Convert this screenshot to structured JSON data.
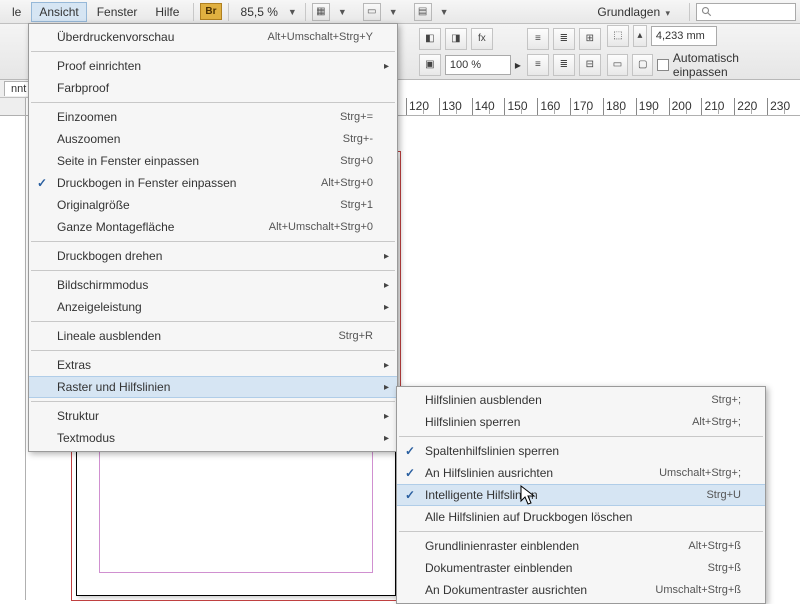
{
  "menubar": {
    "items_left": [
      "le"
    ],
    "items": [
      "Ansicht",
      "Fenster",
      "Hilfe"
    ],
    "bridge": "Br",
    "zoom": "85,5 %",
    "workspace": "Grundlagen"
  },
  "toolbar": {
    "pct": "100 %",
    "field_value": "4,233 mm",
    "fx_label": "fx",
    "autofit": "Automatisch einpassen"
  },
  "ruler": {
    "ticks": [
      "120",
      "130",
      "140",
      "150",
      "160",
      "170",
      "180",
      "190",
      "200",
      "210",
      "220",
      "230"
    ]
  },
  "tab": {
    "label": "nnt"
  },
  "view_menu": {
    "groups": [
      [
        {
          "label": "Überdruckenvorschau",
          "shortcut": "Alt+Umschalt+Strg+Y"
        }
      ],
      [
        {
          "label": "Proof einrichten",
          "sub": true
        },
        {
          "label": "Farbproof"
        }
      ],
      [
        {
          "label": "Einzoomen",
          "shortcut": "Strg+="
        },
        {
          "label": "Auszoomen",
          "shortcut": "Strg+-"
        },
        {
          "label": "Seite in Fenster einpassen",
          "shortcut": "Strg+0"
        },
        {
          "label": "Druckbogen in Fenster einpassen",
          "shortcut": "Alt+Strg+0",
          "checked": true
        },
        {
          "label": "Originalgröße",
          "shortcut": "Strg+1"
        },
        {
          "label": "Ganze Montagefläche",
          "shortcut": "Alt+Umschalt+Strg+0"
        }
      ],
      [
        {
          "label": "Druckbogen drehen",
          "sub": true
        }
      ],
      [
        {
          "label": "Bildschirmmodus",
          "sub": true
        },
        {
          "label": "Anzeigeleistung",
          "sub": true
        }
      ],
      [
        {
          "label": "Lineale ausblenden",
          "shortcut": "Strg+R"
        }
      ],
      [
        {
          "label": "Extras",
          "sub": true
        },
        {
          "label": "Raster und Hilfslinien",
          "sub": true,
          "hover": true
        }
      ],
      [
        {
          "label": "Struktur",
          "sub": true
        },
        {
          "label": "Textmodus",
          "sub": true
        }
      ]
    ]
  },
  "grid_submenu": {
    "groups": [
      [
        {
          "label": "Hilfslinien ausblenden",
          "shortcut": "Strg+;"
        },
        {
          "label": "Hilfslinien sperren",
          "shortcut": "Alt+Strg+;"
        }
      ],
      [
        {
          "label": "Spaltenhilfslinien sperren",
          "checked": true
        },
        {
          "label": "An Hilfslinien ausrichten",
          "shortcut": "Umschalt+Strg+;",
          "checked": true
        },
        {
          "label": "Intelligente Hilfslinien",
          "shortcut": "Strg+U",
          "checked": true,
          "hover": true
        },
        {
          "label": "Alle Hilfslinien auf Druckbogen löschen"
        }
      ],
      [
        {
          "label": "Grundlinienraster einblenden",
          "shortcut": "Alt+Strg+ß"
        },
        {
          "label": "Dokumentraster einblenden",
          "shortcut": "Strg+ß"
        },
        {
          "label": "An Dokumentraster ausrichten",
          "shortcut": "Umschalt+Strg+ß"
        }
      ]
    ]
  }
}
